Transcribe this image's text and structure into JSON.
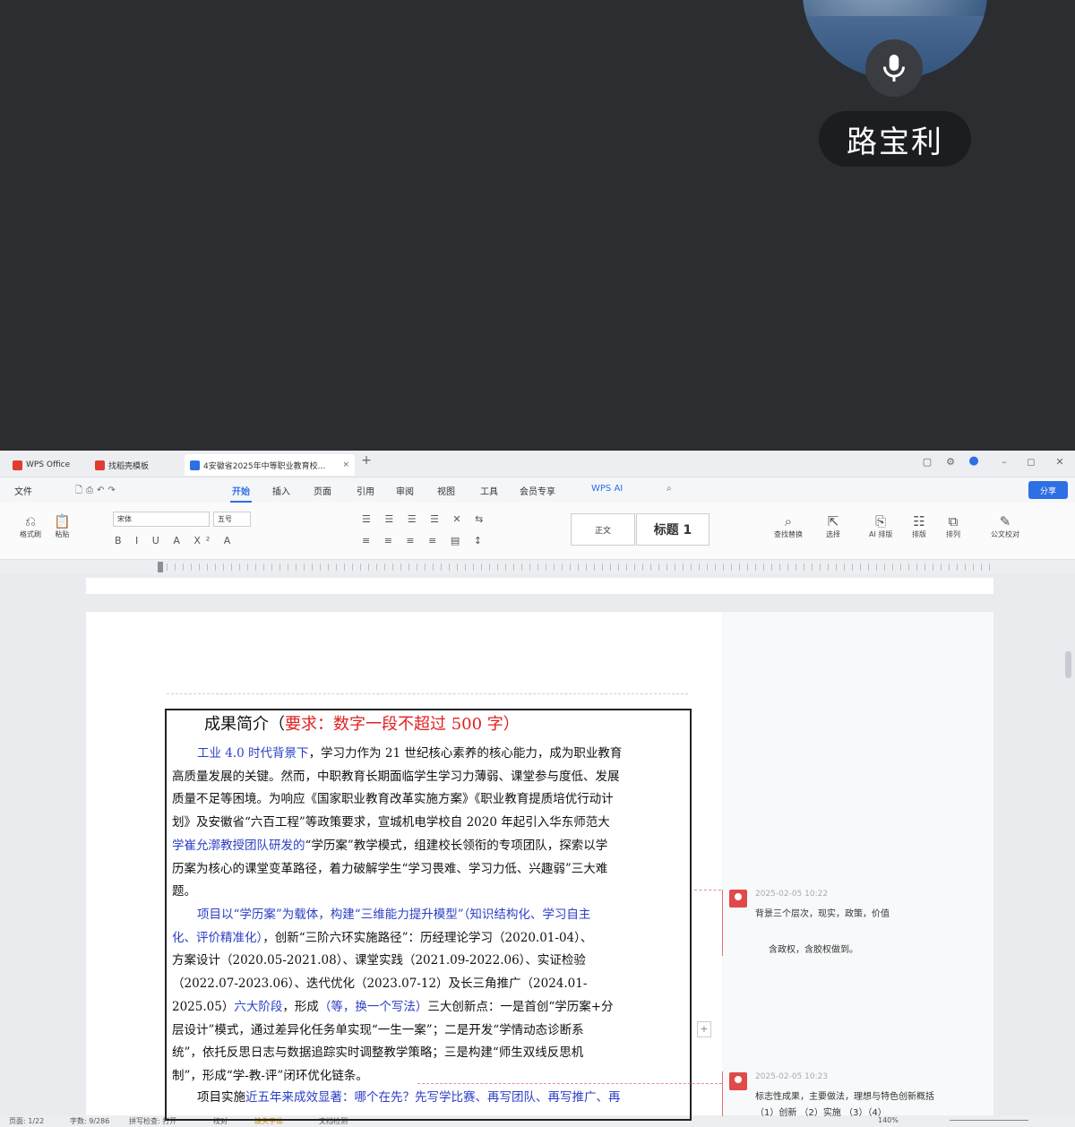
{
  "call": {
    "participant_name": "路宝利"
  },
  "tabs": [
    {
      "label": "WPS Office",
      "color": "#e03c31"
    },
    {
      "label": "找稻壳模板",
      "color": "#e03c31"
    },
    {
      "label": "4安徽省2025年中等职业教育校...",
      "color": "#2f6fe4"
    }
  ],
  "menu": {
    "items": [
      "文件",
      "开始",
      "插入",
      "页面",
      "引用",
      "审阅",
      "视图",
      "工具",
      "会员专享",
      "WPS AI"
    ],
    "active": "开始",
    "share": "分享"
  },
  "ribbon": {
    "format_brush": "格式刷",
    "paste": "粘贴",
    "font_name": "宋体",
    "font_size": "五号",
    "style_normal": "正文",
    "style_heading": "标题 1",
    "find_replace": "查找替换",
    "select": "选择",
    "ai_layout": "AI 排版",
    "layout": "排版",
    "arrange": "排列",
    "doc_correct": "公文校对"
  },
  "document": {
    "title_prefix": "成果简介（",
    "title_req": "要求：数字一段不超过 500 字）",
    "p1": [
      [
        {
          "t": "工业 4.0 时代背景下",
          "c": "blue"
        },
        {
          "t": "，学习力作为 21 世纪核心素养的核心能力，成为职业教育"
        }
      ],
      [
        {
          "t": "高质量发展的关键。然而，中职教育长期面临学生学习力薄弱、课堂参与度低、发展"
        }
      ],
      [
        {
          "t": "质量不足等困境。为响应《国家职业教育改革实施方案》《职业教育提质培优行动计"
        }
      ],
      [
        {
          "t": "划》及安徽省“六百工程”等政策要求，宣城机电学校自 2020 年起引入华东师范大"
        }
      ],
      [
        {
          "t": "学崔允漷教授团队研发的",
          "c": "blue"
        },
        {
          "t": "“学历案”教学模式，组建校长领衔的专项团队，探索以学"
        }
      ],
      [
        {
          "t": "历案为核心的课堂变革路径，着力破解学生“学习畏难、学习力低、兴趣弱”三大难"
        }
      ],
      [
        {
          "t": "题。"
        }
      ]
    ],
    "p2": [
      [
        {
          "t": "项目以“学历案”为载体，构建“三维能力提升模型”（",
          "c": "blue"
        },
        {
          "t": "知识结构化、学习自主",
          "c": "blue"
        }
      ],
      [
        {
          "t": "化、评价精准化）",
          "c": "blue"
        },
        {
          "t": "，创新“三阶六环实施路径”：历经理论学习（2020.01-04）、"
        }
      ],
      [
        {
          "t": "方案设计（2020.05-2021.08）、课堂实践（2021.09-2022.06）、实证检验"
        }
      ],
      [
        {
          "t": "（2022.07-2023.06）、迭代优化（2023.07-12）及长三角推广（2024.01-"
        }
      ],
      [
        {
          "t": "2025.05）"
        },
        {
          "t": "六大阶段",
          "c": "blue"
        },
        {
          "t": "，形成"
        },
        {
          "t": "（等，换一个写法）",
          "c": "blue"
        },
        {
          "t": "三大创新点：一是首创“学历案+分"
        }
      ],
      [
        {
          "t": "层设计”模式，通过差异化任务单实现“一生一案”；二是开发“学情动态诊断系"
        }
      ],
      [
        {
          "t": "统”，依托反思日志与数据追踪实时调整教学策略；三是构建“师生双线反思机"
        }
      ],
      [
        {
          "t": "制”，形成“学-教-评”闭环优化链条。"
        }
      ]
    ],
    "p3": [
      [
        {
          "t": "项目实施"
        },
        {
          "t": "近五年来成效显著：哪个在先？先写学比赛、再写团队、再写推广、再",
          "c": "blue"
        }
      ]
    ]
  },
  "comments": [
    {
      "time": "2025-02-05 10:22",
      "line1": "背景三个层次，现实，政策，价值",
      "line2": "含政权，含胶权做到。"
    },
    {
      "time": "2025-02-05 10:23",
      "line1": "标志性成果，主要做法，理想与特色创新概括",
      "line2": "（1）创新    （2）实施    （3）（4）"
    }
  ],
  "status": {
    "page": "页面: 1/22",
    "words": "字数: 9/286",
    "spell": "拼写检查: 打开",
    "proof": "校对",
    "missing_font": "缺失字体",
    "doc_check": "文档检测",
    "zoom": "140%"
  }
}
